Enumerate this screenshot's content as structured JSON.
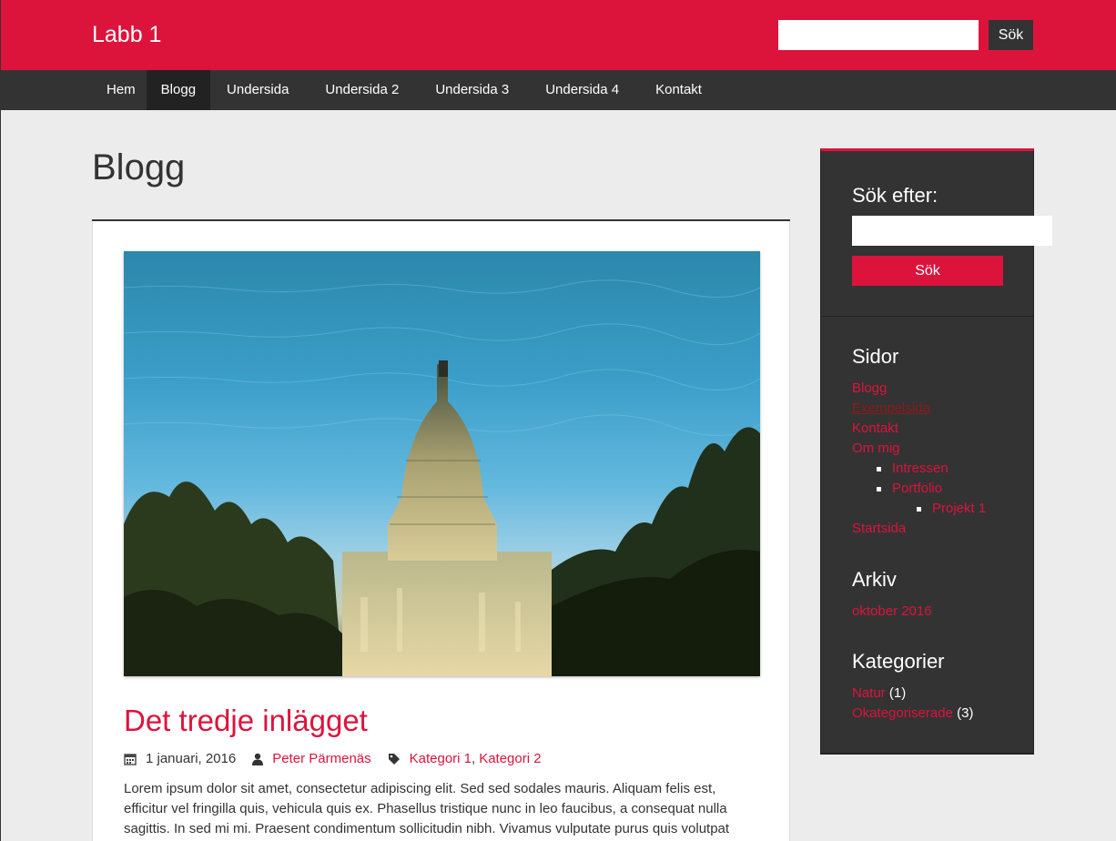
{
  "header": {
    "site_title": "Labb 1",
    "search_button": "Sök",
    "search_value": ""
  },
  "nav": {
    "items": [
      {
        "label": "Hem"
      },
      {
        "label": "Blogg"
      },
      {
        "label": "Undersida"
      },
      {
        "label": "Undersida 2"
      },
      {
        "label": "Undersida 3"
      },
      {
        "label": "Undersida 4"
      },
      {
        "label": "Kontakt"
      }
    ],
    "active": "Blogg"
  },
  "main": {
    "page_title": "Blogg",
    "post": {
      "title": "Det tredje inlägget",
      "date": "1 januari, 2016",
      "author": "Peter Pärmenäs",
      "categories": [
        "Kategori 1",
        "Kategori 2"
      ],
      "category_separator": ",",
      "excerpt": "Lorem ipsum dolor sit amet, consectetur adipiscing elit. Sed sed sodales mauris. Aliquam felis est, efficitur vel fringilla quis, vehicula quis ex. Phasellus tristique nunc in leo faucibus, a consequat nulla sagittis. In sed mi mi. Praesent condimentum sollicitudin nibh. Vivamus vulputate purus quis volutpat",
      "image_alt": "capitol-reflection-photo"
    }
  },
  "sidebar": {
    "search": {
      "heading": "Sök efter:",
      "button": "Sök",
      "value": ""
    },
    "pages": {
      "heading": "Sidor",
      "items": [
        {
          "label": "Blogg",
          "level": 1
        },
        {
          "label": "Exempelsida",
          "level": 1
        },
        {
          "label": "Kontakt",
          "level": 1
        },
        {
          "label": "Om mig",
          "level": 1
        },
        {
          "label": "Intressen",
          "level": 2
        },
        {
          "label": "Portfolio",
          "level": 2
        },
        {
          "label": "Projekt 1",
          "level": 3
        },
        {
          "label": "Startsida",
          "level": 1
        }
      ]
    },
    "archive": {
      "heading": "Arkiv",
      "items": [
        {
          "label": "oktober 2016"
        }
      ]
    },
    "categories": {
      "heading": "Kategorier",
      "items": [
        {
          "label": "Natur",
          "count": "(1)"
        },
        {
          "label": "Okategoriserade",
          "count": "(3)"
        }
      ]
    }
  },
  "colors": {
    "accent": "#dc143c",
    "dark": "#333333",
    "background": "#ececec"
  },
  "icons": [
    "calendar-icon",
    "user-icon",
    "tag-icon"
  ]
}
